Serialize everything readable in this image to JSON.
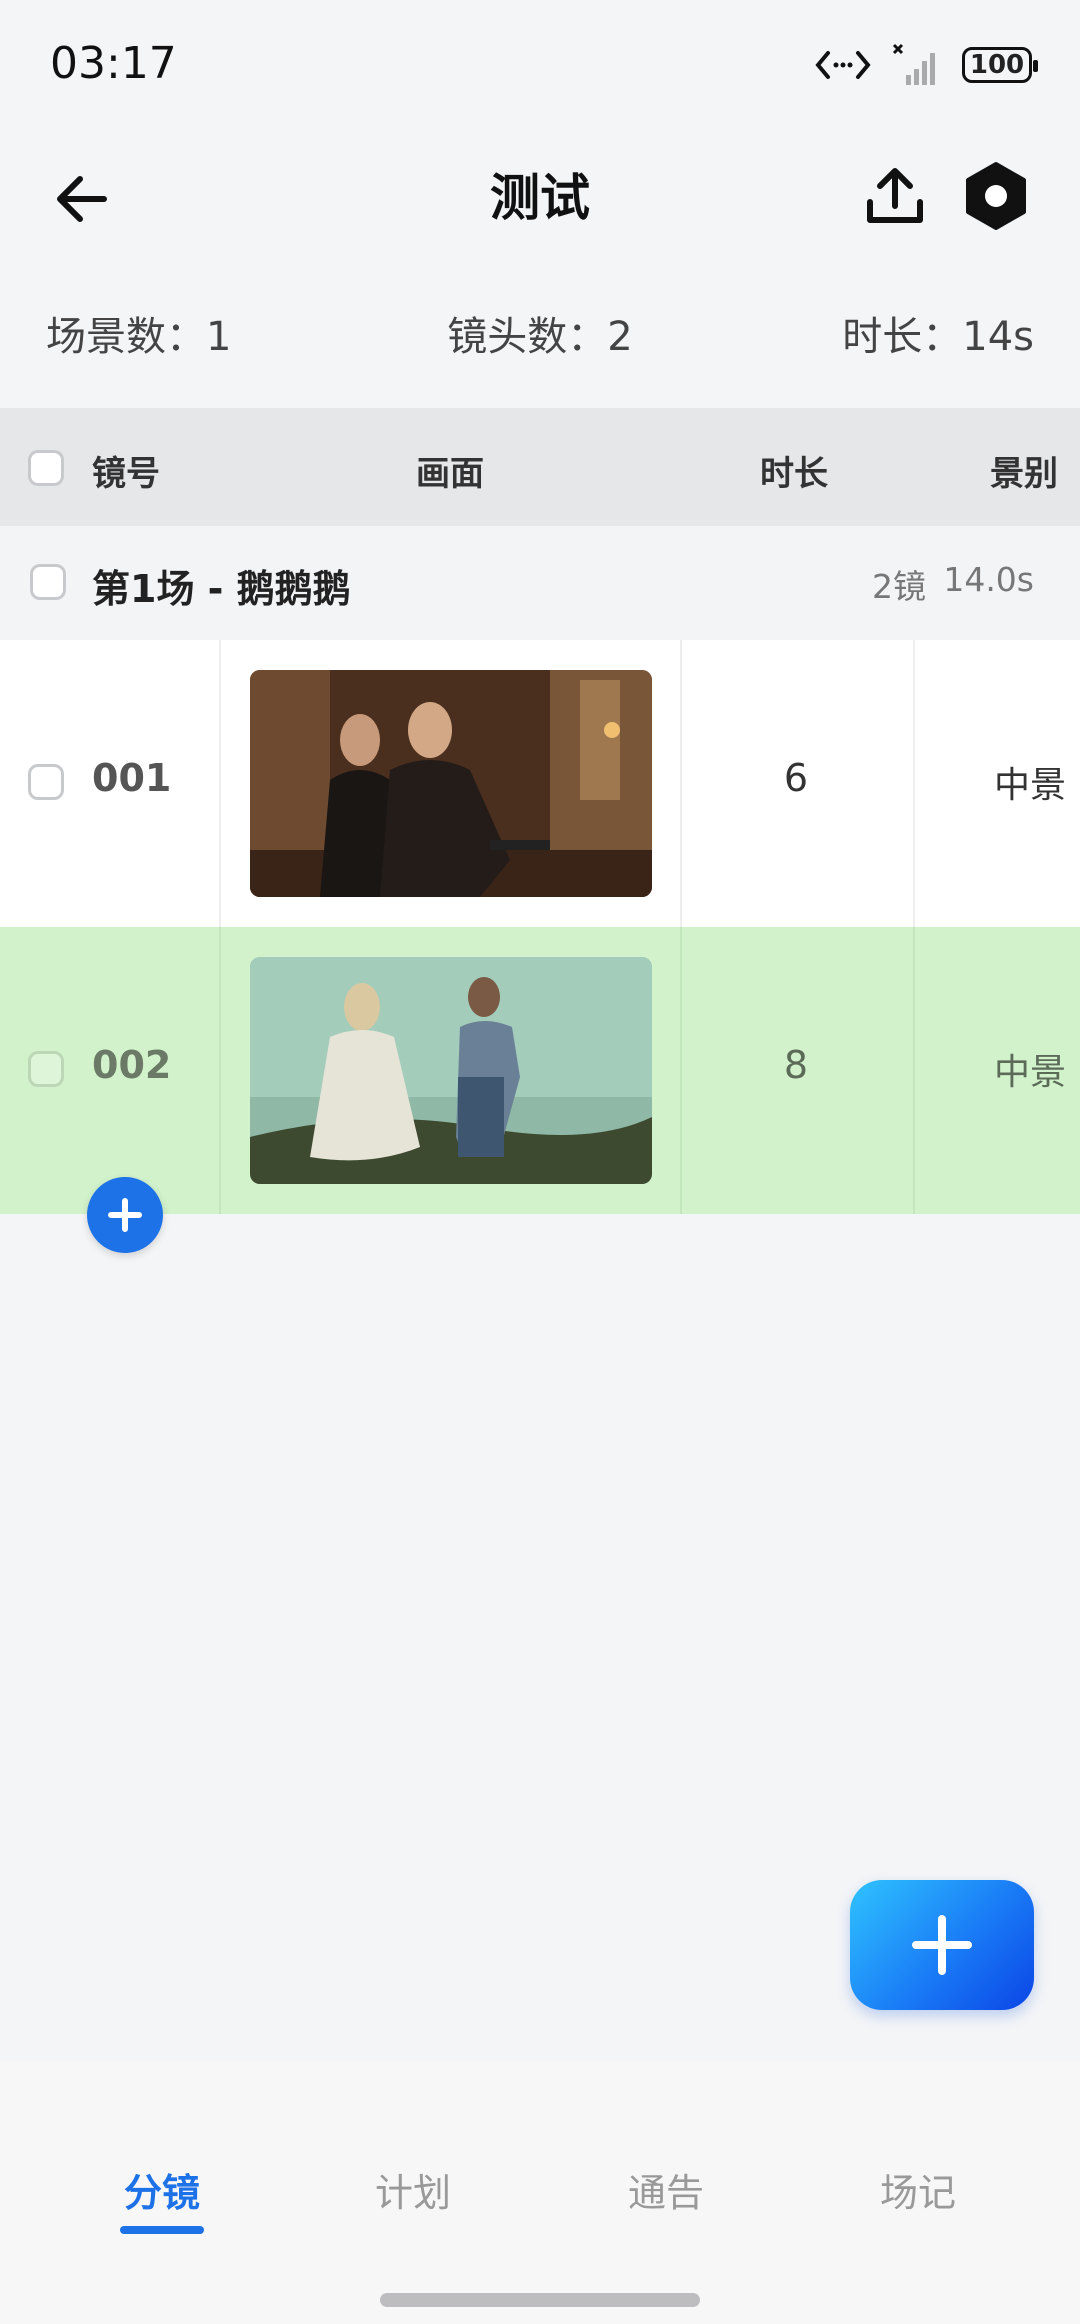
{
  "status": {
    "time": "03:17",
    "battery": "100"
  },
  "header": {
    "title": "测试"
  },
  "summary": {
    "scenes": "场景数：1",
    "shots": "镜头数：2",
    "duration": "时长：14s"
  },
  "table": {
    "columns": [
      "镜号",
      "画面",
      "时长",
      "景别"
    ]
  },
  "scene": {
    "title": "第1场 - 鹅鹅鹅",
    "count": "2镜",
    "duration": "14.0s"
  },
  "shots": [
    {
      "no": "001",
      "duration": "6",
      "size": "中景"
    },
    {
      "no": "002",
      "duration": "8",
      "size": "中景"
    }
  ],
  "tabs": [
    {
      "label": "分镜"
    },
    {
      "label": "计划"
    },
    {
      "label": "通告"
    },
    {
      "label": "场记"
    }
  ],
  "colors": {
    "accent": "#1d72e8",
    "selected_row": "#d2f2cb"
  }
}
